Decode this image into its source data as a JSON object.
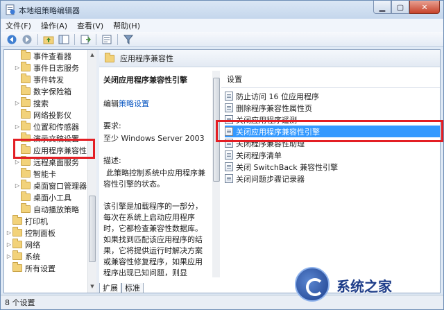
{
  "window": {
    "title": "本地组策略编辑器"
  },
  "menu": [
    "文件(F)",
    "操作(A)",
    "查看(V)",
    "帮助(H)"
  ],
  "tree": [
    {
      "label": "事件查看器",
      "arrow": false
    },
    {
      "label": "事件日志服务",
      "arrow": true
    },
    {
      "label": "事件转发",
      "arrow": false
    },
    {
      "label": "数字保险箱",
      "arrow": false
    },
    {
      "label": "搜索",
      "arrow": true
    },
    {
      "label": "网络投影仪",
      "arrow": false
    },
    {
      "label": "位置和传感器",
      "arrow": true
    },
    {
      "label": "演示文稿设置",
      "arrow": false
    },
    {
      "label": "应用程序兼容性",
      "arrow": false
    },
    {
      "label": "远程桌面服务",
      "arrow": true
    },
    {
      "label": "智能卡",
      "arrow": false
    },
    {
      "label": "桌面窗口管理器",
      "arrow": true
    },
    {
      "label": "桌面小工具",
      "arrow": false
    },
    {
      "label": "自动播放策略",
      "arrow": false
    },
    {
      "label": "打印机",
      "arrow": false
    },
    {
      "label": "控制面板",
      "arrow": true
    },
    {
      "label": "网络",
      "arrow": true
    },
    {
      "label": "系统",
      "arrow": true
    },
    {
      "label": "所有设置",
      "arrow": false
    }
  ],
  "pane": {
    "header_title": "应用程序兼容性",
    "desc_title": "关闭应用程序兼容性引擎",
    "edit_prefix": "编辑",
    "edit_link": "策略设置",
    "req_label": "要求:",
    "req_value": "至少 Windows Server 2003",
    "desc_label": "描述:",
    "desc_line1": "此策略控制系统中应用程序兼容性引擎的状态。",
    "desc_para2": "该引擎是加载程序的一部分，每次在系统上启动应用程序时，它都检查兼容性数据库。如果找到匹配该应用程序的结果，它将提供运行时解决方案或兼容性修复程序，如果应用程序出现已知问题，则显示“应用程序帮助”消息。",
    "settings_header": "设置"
  },
  "settings": [
    "防止访问 16 位应用程序",
    "删除程序兼容性属性页",
    "关闭应用程序遥测",
    "关闭应用程序兼容性引擎",
    "关闭程序兼容性助理",
    "关闭程序清单",
    "关闭 SwitchBack 兼容性引擎",
    "关闭问题步骤记录器"
  ],
  "selected_setting_index": 3,
  "tabs": [
    "扩展",
    "标准"
  ],
  "status": "8 个设置",
  "watermark": {
    "text": "系统之家"
  },
  "colors": {
    "selection": "#3399ff",
    "highlight_box": "#e31e24",
    "link": "#0a57c2"
  }
}
